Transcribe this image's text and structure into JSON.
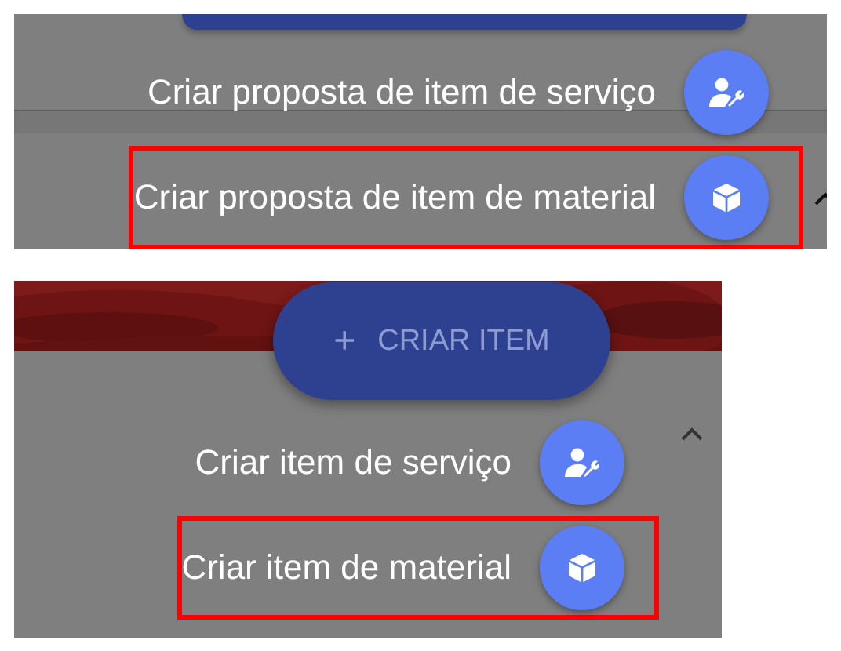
{
  "panels": [
    {
      "main_button": {
        "kind": "cut"
      },
      "actions": [
        {
          "label": "Criar proposta de item de serviço",
          "highlighted": false
        },
        {
          "label": "Criar proposta de item de material",
          "highlighted": true
        }
      ]
    },
    {
      "main_button": {
        "kind": "full",
        "icon": "+",
        "label": "CRIAR ITEM"
      },
      "actions": [
        {
          "label": "Criar item de serviço",
          "highlighted": false
        },
        {
          "label": "Criar item de material",
          "highlighted": true
        }
      ]
    }
  ]
}
